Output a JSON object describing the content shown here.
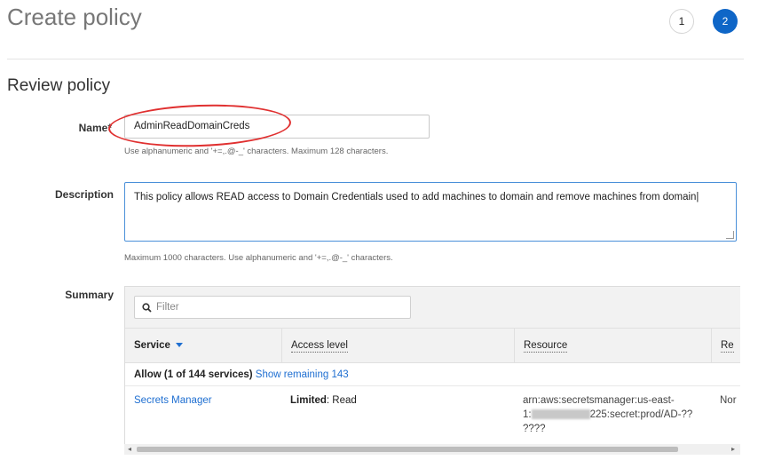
{
  "page": {
    "title": "Create policy"
  },
  "steps": [
    {
      "label": "1"
    },
    {
      "label": "2"
    }
  ],
  "review": {
    "title": "Review policy"
  },
  "name_field": {
    "label": "Name*",
    "value": "AdminReadDomainCreds",
    "hint": "Use alphanumeric and '+=,.@-_' characters. Maximum 128 characters."
  },
  "description_field": {
    "label": "Description",
    "value": "This policy allows READ access to Domain Credentials used to add machines to domain and remove machines from domain|",
    "hint": "Maximum 1000 characters. Use alphanumeric and '+=,.@-_' characters."
  },
  "summary": {
    "label": "Summary",
    "filter_placeholder": "Filter",
    "columns": {
      "service": "Service",
      "access": "Access level",
      "resource": "Resource",
      "request": "Re"
    },
    "allow_text": "Allow (1 of 144 services)",
    "show_remaining": "Show remaining 143",
    "row": {
      "service": "Secrets Manager",
      "access_bold": "Limited",
      "access_rest": ": Read",
      "resource_line1": "arn:aws:secretsmanager:us-east-",
      "resource_prefix": "1:",
      "resource_suffix": "225:secret:prod/AD-??",
      "resource_line3": "????",
      "request": "Nor"
    }
  },
  "colors": {
    "accent": "#0f66c7",
    "link": "#1f6fd1",
    "annotation": "#e03030"
  },
  "icons": [
    "search-icon",
    "sort-caret-icon",
    "scroll-left-icon",
    "scroll-right-icon"
  ]
}
